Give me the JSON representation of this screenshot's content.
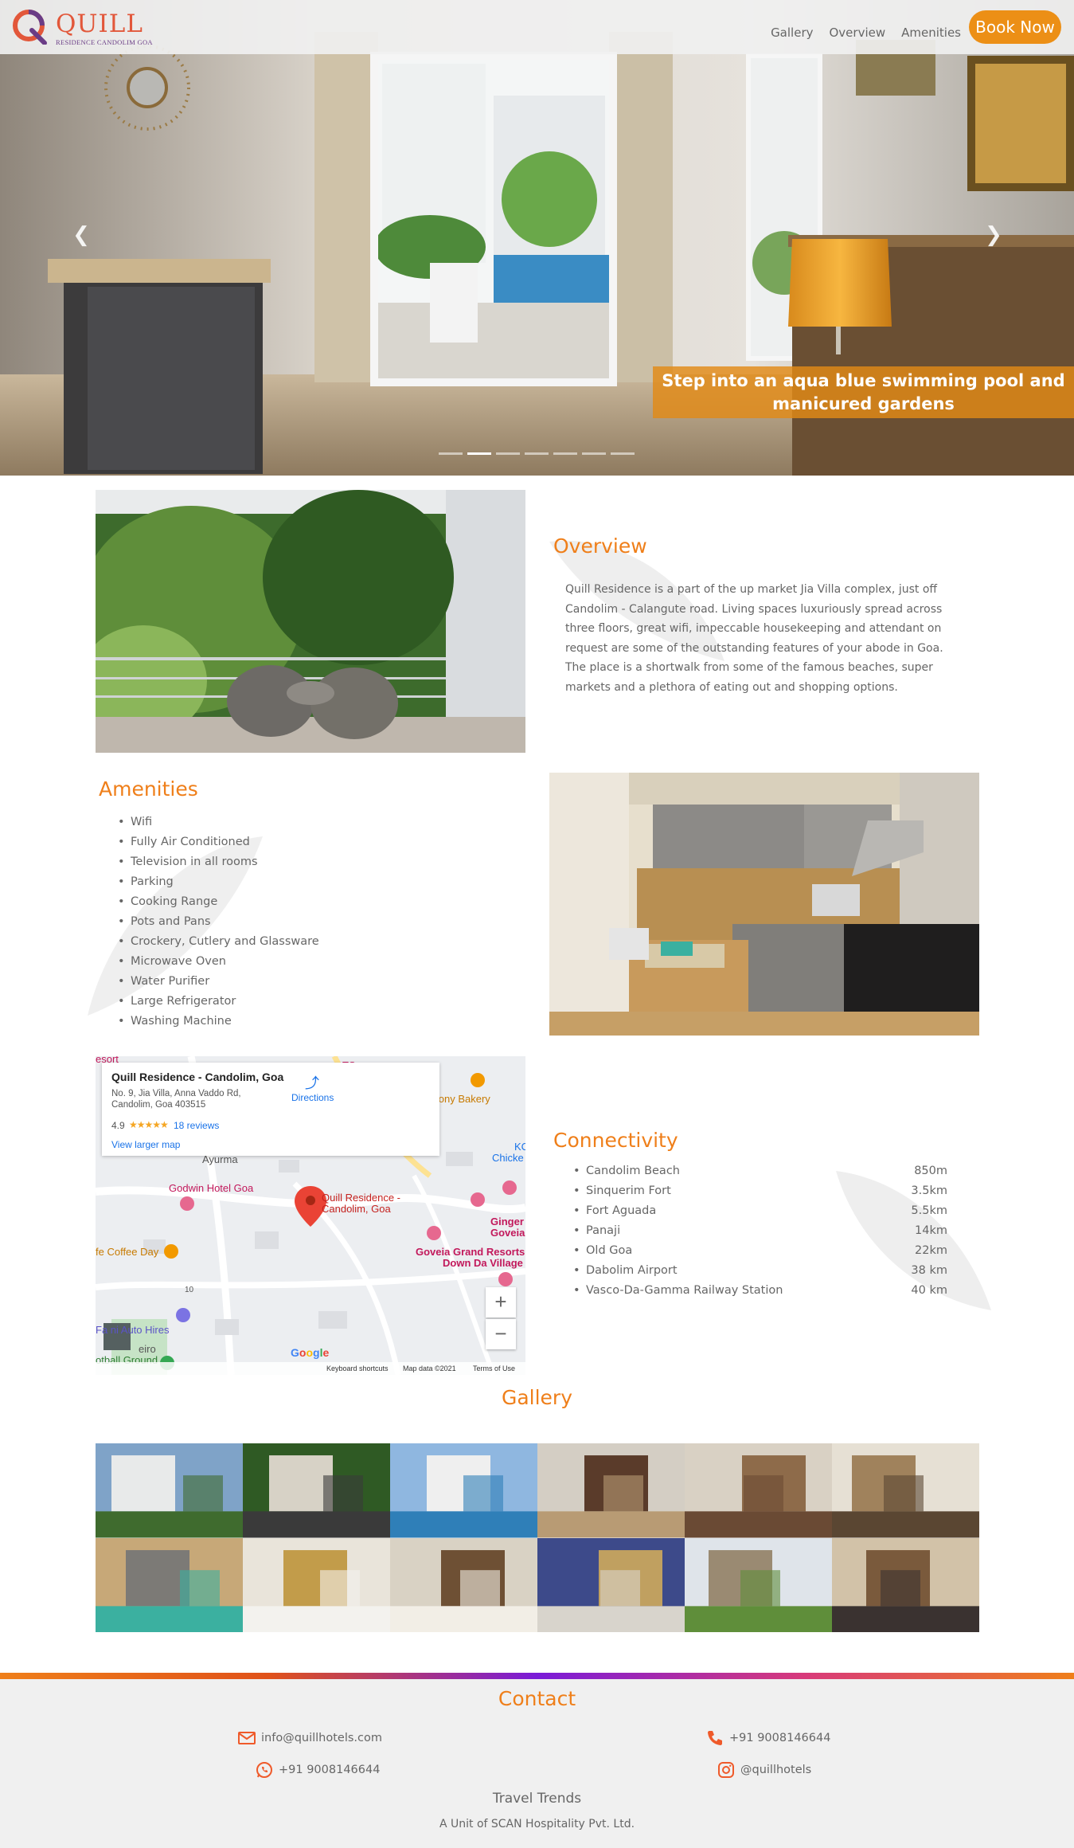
{
  "brand": {
    "name": "QUILL",
    "tagline": "RESIDENCE CANDOLIM GOA"
  },
  "nav": {
    "gallery": "Gallery",
    "overview": "Overview",
    "amenities": "Amenities",
    "book": "Book Now"
  },
  "hero": {
    "caption": "Step into an aqua blue swimming pool and manicured gardens",
    "slide_count": 7,
    "active_slide": 2
  },
  "overview": {
    "title": "Overview",
    "text": "Quill Residence is a part of the up market Jia Villa complex, just off Candolim - Calangute road. Living spaces luxuriously spread across three floors, great wifi, impeccable housekeeping and attendant on request are some of the outstanding features of your abode in Goa. The place is a shortwalk from some of the famous beaches, super markets and a plethora of eating out and shopping options."
  },
  "amenities": {
    "title": "Amenities",
    "items": [
      "Wifi",
      "Fully Air Conditioned",
      "Television in all rooms",
      "Parking",
      "Cooking Range",
      "Pots and Pans",
      "Crockery, Cutlery and Glassware",
      "Microwave Oven",
      "Water Purifier",
      "Large Refrigerator",
      "Washing Machine"
    ]
  },
  "map": {
    "place_name": "Quill Residence - Candolim, Goa",
    "address": "No. 9, Jia Villa, Anna Vaddo Rd, Candolim, Goa 403515",
    "rating": "4.9",
    "stars": "★★★★★",
    "reviews": "18 reviews",
    "view_larger": "View larger map",
    "directions": "Directions",
    "labels": {
      "resort": "esort",
      "anthony": "Anthony Bakery",
      "ayurma": "Ayurma",
      "godwin": "Godwin Hotel Goa",
      "quill": "Quill Residence -",
      "quill2": "Candolim, Goa",
      "ginger": "Ginger",
      "ginger2": "Goveia",
      "goveia": "Goveia Grand Resorts",
      "goveia2": "Down Da Village",
      "coffee": "fe Coffee Day",
      "auto": "Fa  ni Auto Hires",
      "ground": "otball Ground",
      "eiro": "eiro",
      "kc": "KC",
      "chick": "Chicke",
      "ts": "TS",
      "road": "10"
    },
    "footer": {
      "shortcuts": "Keyboard shortcuts",
      "data": "Map data ©2021",
      "terms": "Terms of Use"
    },
    "google": "Google",
    "zoom_in": "+",
    "zoom_out": "−"
  },
  "connectivity": {
    "title": "Connectivity",
    "items": [
      {
        "place": "Candolim Beach",
        "distance": "850m"
      },
      {
        "place": "Sinquerim Fort",
        "distance": "3.5km"
      },
      {
        "place": "Fort Aguada",
        "distance": "5.5km"
      },
      {
        "place": "Panaji",
        "distance": "14km"
      },
      {
        "place": "Old Goa",
        "distance": "22km"
      },
      {
        "place": "Dabolim Airport",
        "distance": "38 km"
      },
      {
        "place": "Vasco-Da-Gamma Railway Station",
        "distance": "40 km"
      }
    ]
  },
  "gallery": {
    "title": "Gallery",
    "tile_count": 12
  },
  "contact": {
    "title": "Contact",
    "email": "info@quillhotels.com",
    "phone": "+91 9008146644",
    "whatsapp": "+91 9008146644",
    "instagram": "@quillhotels",
    "brand": "Travel Trends",
    "unit": "A Unit of SCAN Hospitality Pvt. Ltd."
  },
  "colors": {
    "accent": "#ef7f1a",
    "button": "#ec8f16",
    "logo_red": "#e2573a",
    "logo_purple": "#6a3c86"
  }
}
